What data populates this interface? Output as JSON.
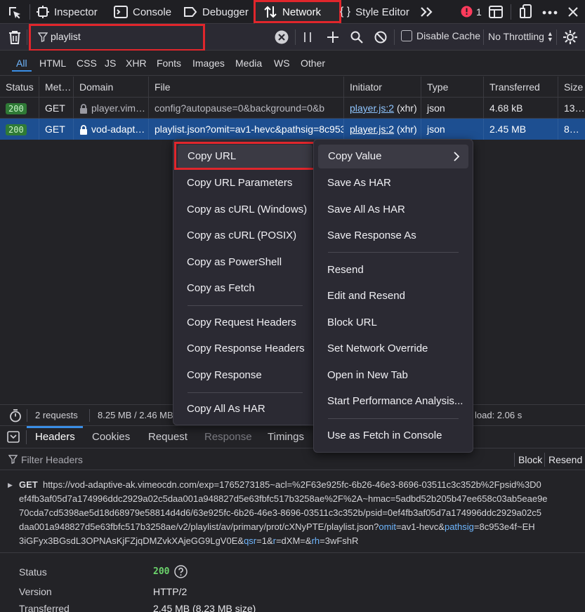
{
  "toolbar": {
    "tabs": [
      {
        "label": "Inspector"
      },
      {
        "label": "Console"
      },
      {
        "label": "Debugger"
      },
      {
        "label": "Network"
      },
      {
        "label": "Style Editor"
      }
    ],
    "error_count": "1"
  },
  "filter": {
    "value": "playlist",
    "disable_cache_label": "Disable Cache",
    "throttling_label": "No Throttling"
  },
  "types": [
    "All",
    "HTML",
    "CSS",
    "JS",
    "XHR",
    "Fonts",
    "Images",
    "Media",
    "WS",
    "Other"
  ],
  "table": {
    "columns": [
      "Status",
      "Met…",
      "Domain",
      "File",
      "Initiator",
      "Type",
      "Transferred",
      "Size"
    ],
    "rows": [
      {
        "status": "200",
        "method": "GET",
        "domain": "player.vim…",
        "file": "config?autopause=0&background=0&b",
        "initiator": "player.js:2",
        "initiator_suffix": "(xhr)",
        "type": "json",
        "transferred": "4.68 kB",
        "size": "13…"
      },
      {
        "status": "200",
        "method": "GET",
        "domain": "vod-adapt…",
        "file": "playlist.json?omit=av1-hevc&pathsig=8c953",
        "initiator": "player.js:2",
        "initiator_suffix": "(xhr)",
        "type": "json",
        "transferred": "2.45 MB",
        "size": "8…"
      }
    ]
  },
  "summary": {
    "requests": "2 requests",
    "size": "8.25 MB / 2.46 MB",
    "load": "load: 2.06 s"
  },
  "details": {
    "tabs": [
      "Headers",
      "Cookies",
      "Request",
      "Response",
      "Timings"
    ],
    "filter_placeholder": "Filter Headers",
    "block_label": "Block",
    "resend_label": "Resend",
    "request": {
      "method": "GET",
      "lines": [
        "https://vod-adaptive-ak.vimeocdn.com/exp=1765273185~acl=%2F63e925fc-6b26-46e3-8696-03511c3c352b%2Fpsid%3D0",
        "ef4fb3af05d7a174996ddc2929a02c5daa001a948827d5e63fbfc517b3258ae%2F%2A~hmac=5adbd52b205b47ee658c03ab5eae9e",
        "70cda7cd5398ae5d18d68979e58814d4d6/63e925fc-6b26-46e3-8696-03511c3c352b/psid=0ef4fb3af05d7a174996ddc2929a02c5",
        "daa001a948827d5e63fbfc517b3258ae/v2/playlist/av/primary/prot/cXNyPTE/playlist.json?"
      ],
      "q1k": "omit",
      "q1v": "=av1-hevc&",
      "q2k": "pathsig",
      "q2v": "=8c953e4f~EH",
      "line5a": "3iGFyx3BGsdL3OPNAsKjFZjqDMZvkXAjeGG9LgV0E&",
      "q3k": "qsr",
      "q3v": "=1&",
      "q4k": "r",
      "q4v": "=dXM=&",
      "q5k": "rh",
      "q5v": "=3wFshR"
    },
    "status_label": "Status",
    "status_value": "200",
    "version_label": "Version",
    "version_value": "HTTP/2",
    "transferred_label": "Transferred",
    "transferred_value": "2.45 MB (8.23 MB size)"
  },
  "context_menu": {
    "left": [
      "Copy URL",
      "Copy URL Parameters",
      "Copy as cURL (Windows)",
      "Copy as cURL (POSIX)",
      "Copy as PowerShell",
      "Copy as Fetch",
      "Copy Request Headers",
      "Copy Response Headers",
      "Copy Response",
      "Copy All As HAR"
    ],
    "right": [
      "Copy Value",
      "Save As HAR",
      "Save All As HAR",
      "Save Response As",
      "Resend",
      "Edit and Resend",
      "Block URL",
      "Set Network Override",
      "Open in New Tab",
      "Start Performance Analysis...",
      "Use as Fetch in Console"
    ]
  },
  "colors": {
    "accent": "#3a8ee6",
    "highlight_red": "#e0262c",
    "selected_row": "#1d4f91",
    "status_ok": "#2f7a36"
  },
  "icons": [
    "pick-element-icon",
    "inspector-icon",
    "console-icon",
    "debugger-icon",
    "network-icon",
    "style-editor-icon",
    "more-tools-icon",
    "error-icon",
    "frames-icon",
    "responsive-icon",
    "menu-icon",
    "close-devtools-icon",
    "trash-icon",
    "funnel-icon",
    "clear-filter-icon",
    "pause-icon",
    "add-icon",
    "search-icon",
    "block-icon",
    "settings-icon",
    "lock-icon",
    "stopwatch-icon",
    "toggle-panel-icon",
    "chevron-right-icon",
    "help-icon"
  ]
}
